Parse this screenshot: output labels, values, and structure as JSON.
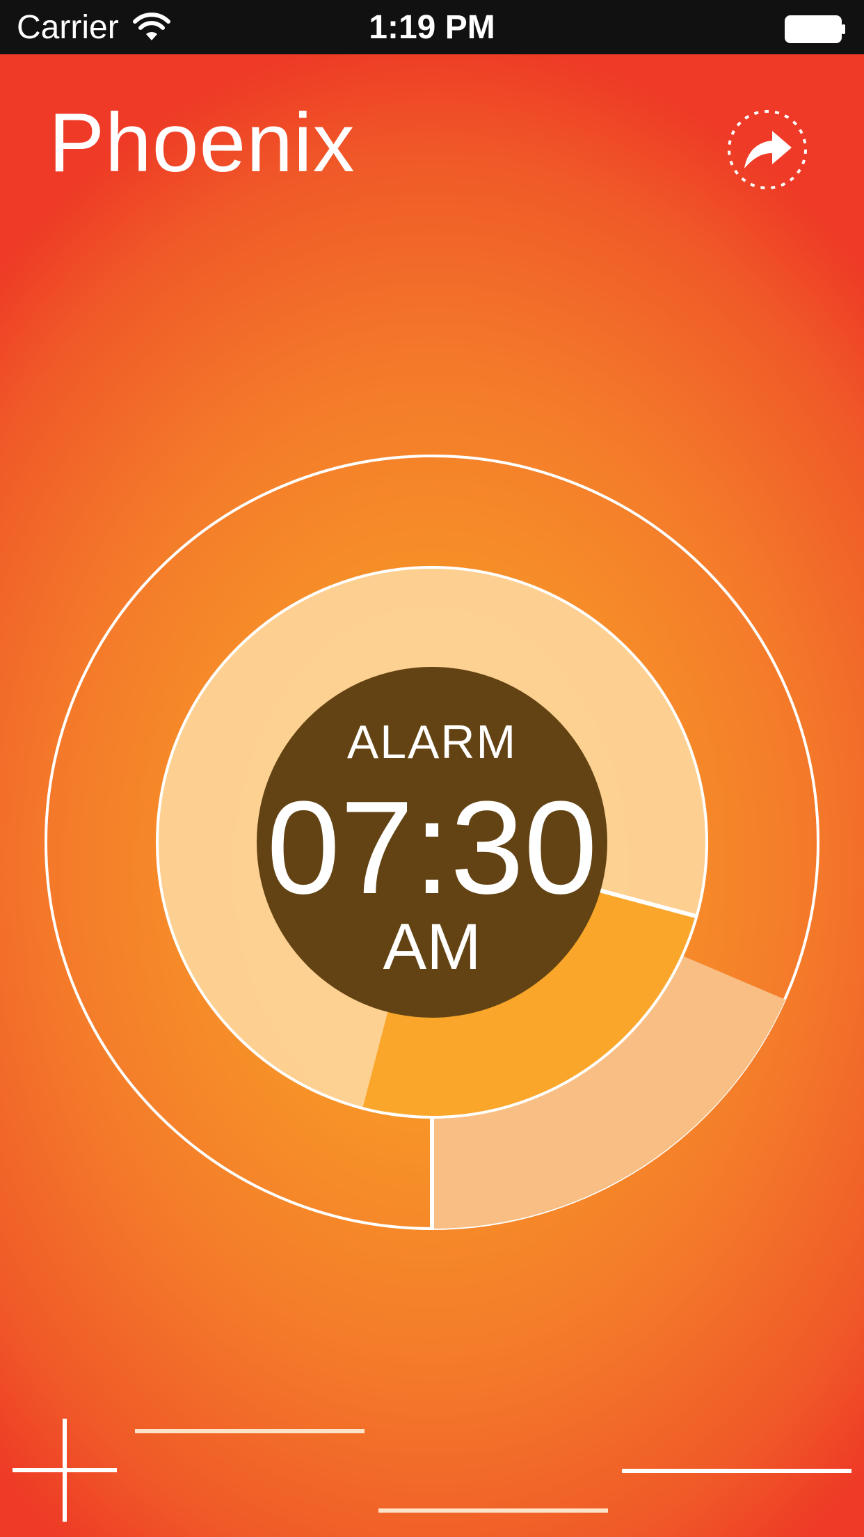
{
  "status_bar": {
    "carrier": "Carrier",
    "time": "1:19 PM"
  },
  "header": {
    "title": "Phoenix",
    "share_icon": "share-icon"
  },
  "alarm": {
    "label": "ALARM",
    "time": "07:30",
    "ampm": "AM"
  },
  "colors": {
    "dial_center": "#634313",
    "inner_ring_fill": "#fdd497",
    "outer_segment_fill": "#f8be83",
    "line": "#ffffff"
  },
  "icons": {
    "add": "plus-icon",
    "wifi": "wifi-icon",
    "battery": "battery-icon"
  }
}
